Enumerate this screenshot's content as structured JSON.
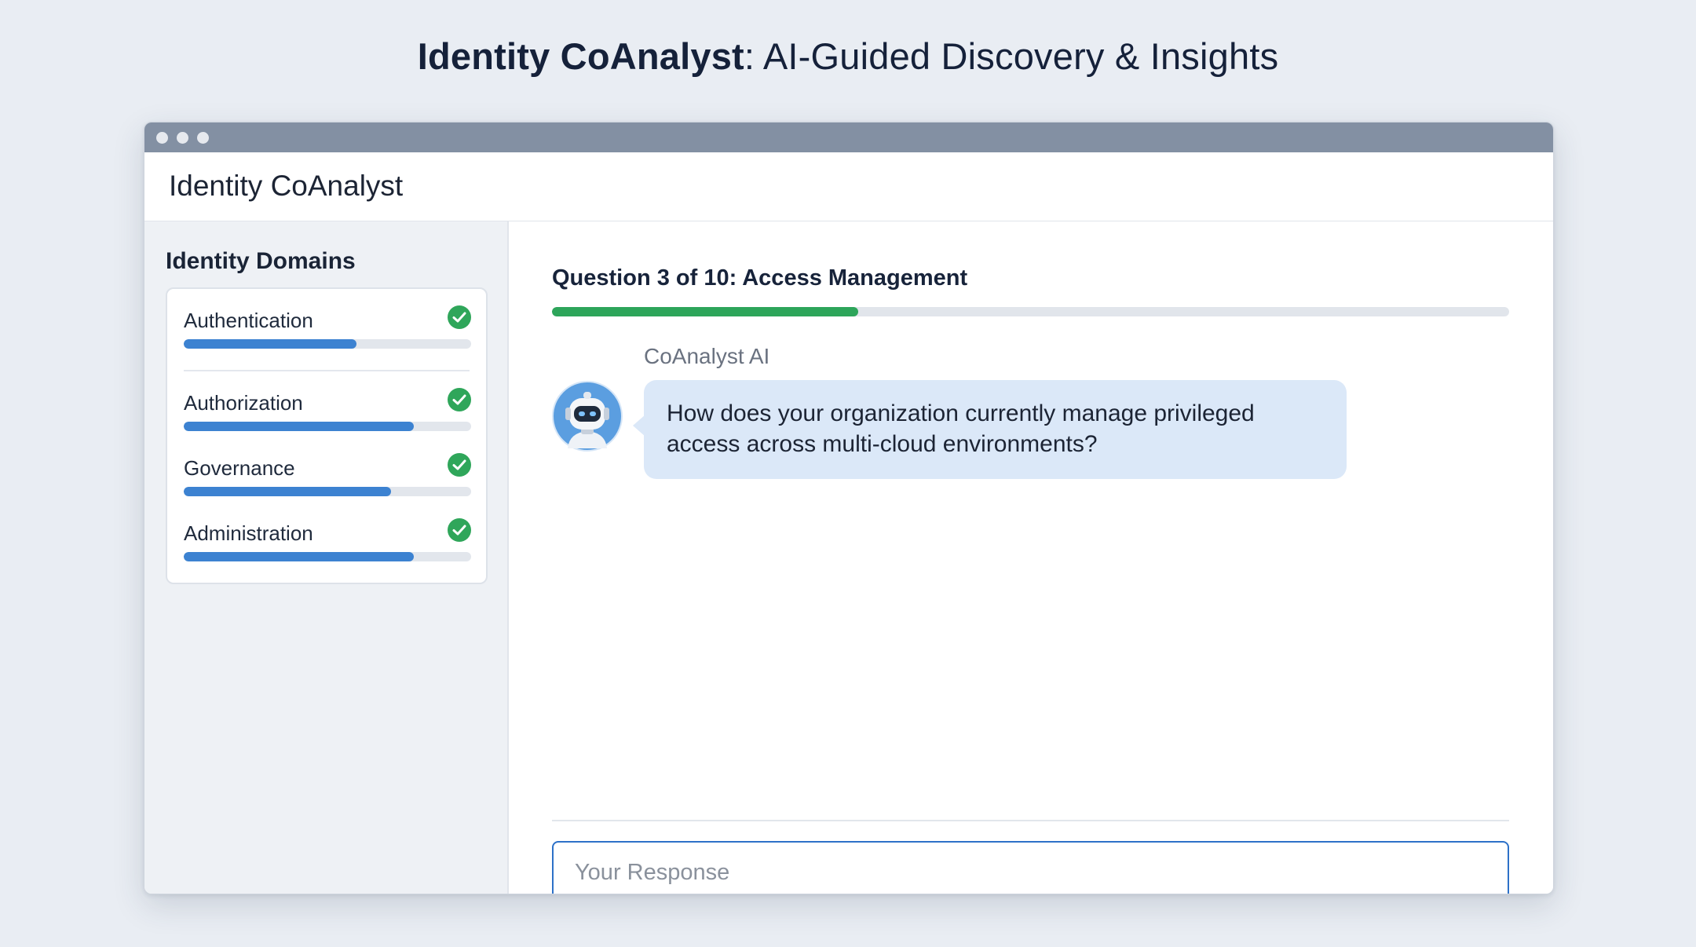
{
  "hero": {
    "title_strong": "Identity CoAnalyst",
    "title_rest": ": AI-Guided Discovery & Insights"
  },
  "app": {
    "title": "Identity CoAnalyst"
  },
  "sidebar": {
    "heading": "Identity Domains",
    "domains": [
      {
        "label": "Authentication",
        "progress": 0.6,
        "status": "complete",
        "icon": "check-circle-icon"
      },
      {
        "label": "Authorization",
        "progress": 0.8,
        "status": "complete",
        "icon": "check-circle-icon"
      },
      {
        "label": "Governance",
        "progress": 0.72,
        "status": "complete",
        "icon": "check-circle-icon"
      },
      {
        "label": "Administration",
        "progress": 0.8,
        "status": "complete",
        "icon": "check-circle-icon"
      }
    ]
  },
  "question": {
    "title": "Question 3 of 10: Access Management",
    "progress": 0.32
  },
  "chat": {
    "sender": "CoAnalyst AI",
    "avatar_icon": "robot-avatar-icon",
    "message": "How does your organization currently manage privileged access across multi-cloud environments?"
  },
  "response": {
    "placeholder": "Your Response",
    "value": ""
  },
  "colors": {
    "background": "#e9edf3",
    "titlebar": "#8390a3",
    "domain_progress": "#3c82d1",
    "question_progress": "#2da55a",
    "check": "#2fa65a",
    "bubble": "#dbe8f8",
    "input_border": "#2d71c8"
  }
}
